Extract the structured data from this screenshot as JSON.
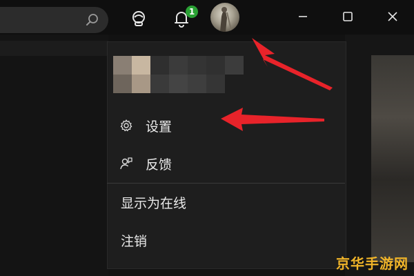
{
  "titlebar": {
    "notifications_count": "1",
    "icons": [
      "search-icon",
      "copilot-icon",
      "bell-icon",
      "avatar",
      "minimize-icon",
      "maximize-icon",
      "close-icon"
    ]
  },
  "menu": {
    "items": [
      {
        "label": "设置",
        "icon": "gear-icon"
      },
      {
        "label": "反馈",
        "icon": "feedback-icon"
      },
      {
        "label": "显示为在线",
        "icon": ""
      },
      {
        "label": "注销",
        "icon": ""
      }
    ]
  },
  "watermark": "京华手游网",
  "colors": {
    "background": "#121212",
    "menu_background": "#1e1e1e",
    "badge": "#2aa134",
    "arrow": "#e8232a",
    "watermark": "#f0b429"
  }
}
